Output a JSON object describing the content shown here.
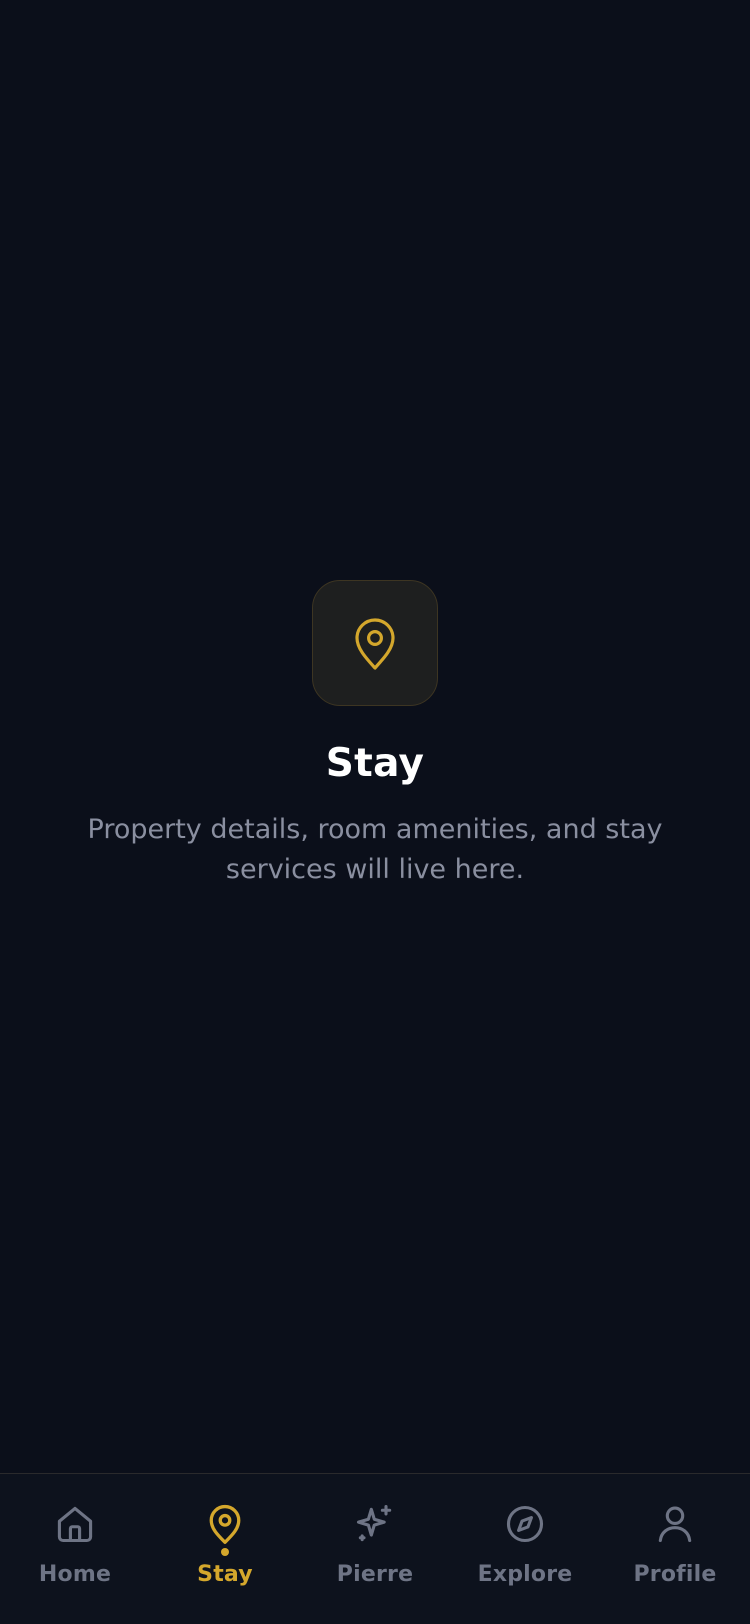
{
  "colors": {
    "background": "#0b0f1a",
    "accent": "#d4a72c",
    "muted": "#6e7485",
    "description": "#8a8fa0"
  },
  "empty_state": {
    "icon": "map-pin-icon",
    "title": "Stay",
    "description": "Property details, room amenities, and stay services will live here."
  },
  "tabbar": {
    "active": "Stay",
    "tabs": [
      {
        "label": "Home",
        "icon": "home-icon"
      },
      {
        "label": "Stay",
        "icon": "map-pin-icon"
      },
      {
        "label": "Pierre",
        "icon": "sparkles-icon"
      },
      {
        "label": "Explore",
        "icon": "compass-icon"
      },
      {
        "label": "Profile",
        "icon": "user-icon"
      }
    ]
  }
}
